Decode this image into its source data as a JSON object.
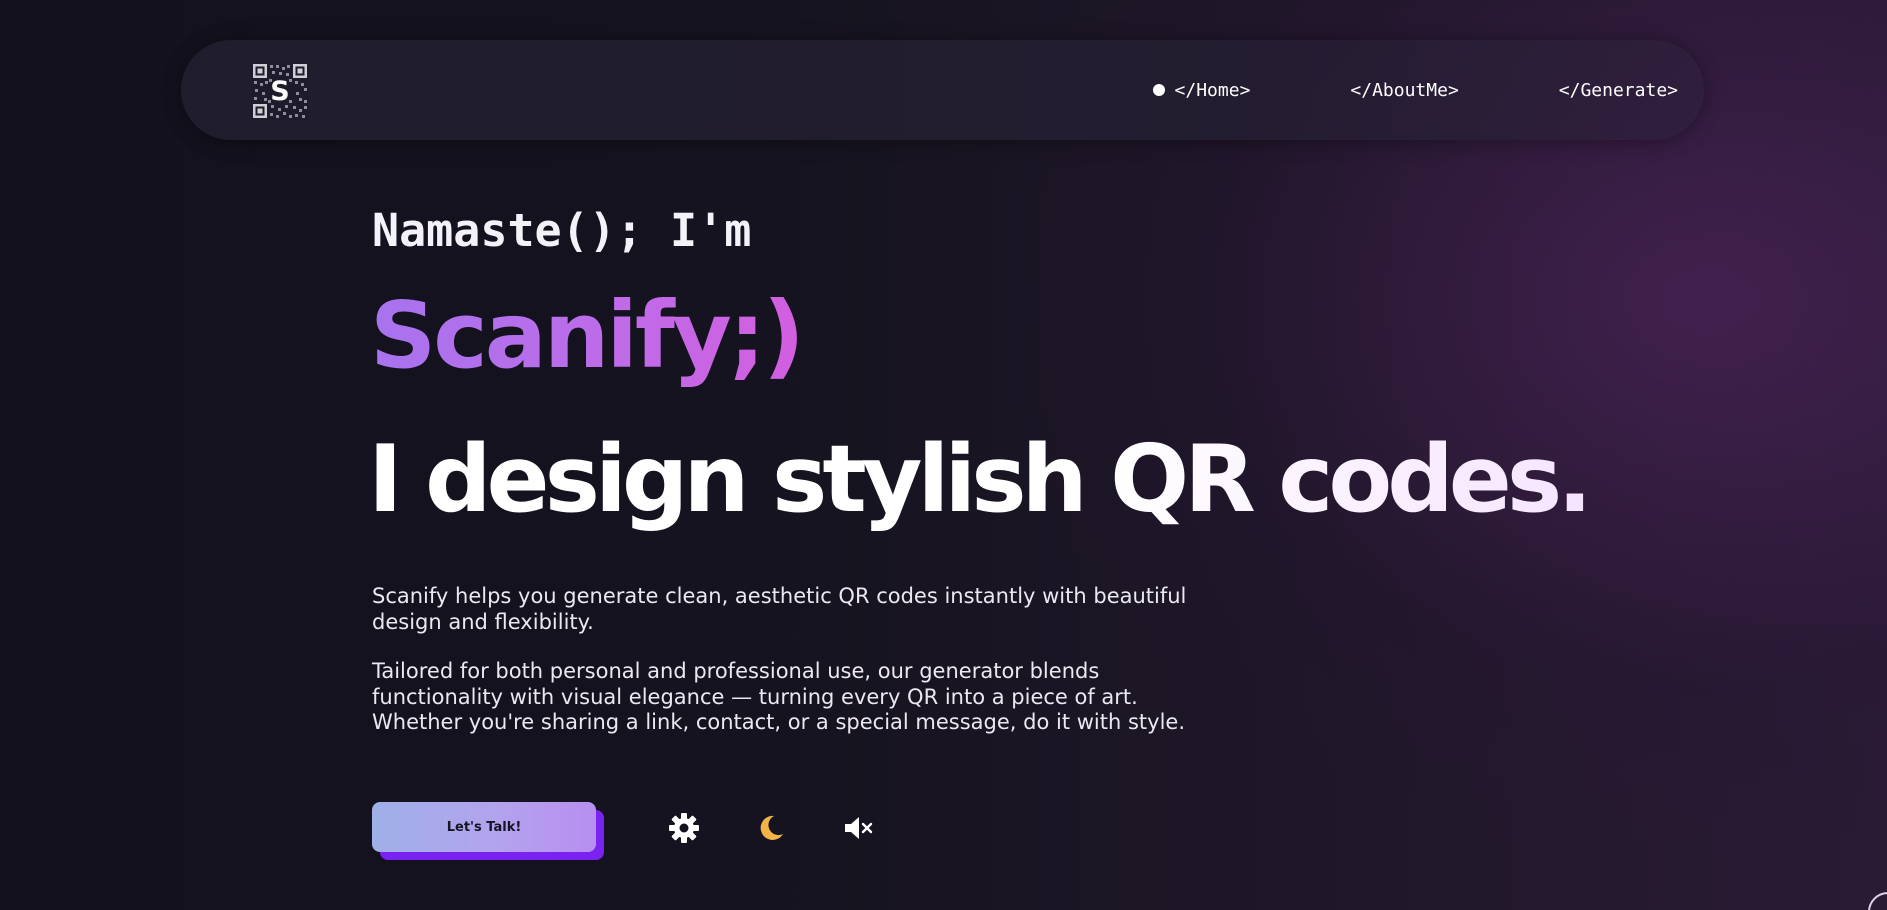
{
  "logo": {
    "letter": "S"
  },
  "nav": {
    "links": [
      {
        "label": "</Home>",
        "active": true
      },
      {
        "label": "</AboutMe>",
        "active": false
      },
      {
        "label": "</Generate>",
        "active": false
      }
    ]
  },
  "hero": {
    "greeting": "Namaste(); I'm",
    "brand": "Scanify;)",
    "tagline": "I design stylish QR codes.",
    "paragraphs": [
      "Scanify helps you generate clean, aesthetic QR codes instantly with beautiful design and flexibility.",
      "Tailored for both personal and professional use, our generator blends functionality with visual elegance — turning every QR into a piece of art. Whether you're sharing a link, contact, or a special message, do it with style."
    ]
  },
  "actions": {
    "cta_label": "Let's Talk!",
    "icons": [
      "gear-icon",
      "moon-icon",
      "speaker-muted-icon"
    ]
  },
  "colors": {
    "brand_gradient_start": "#a873ee",
    "brand_gradient_end": "#d35ee0",
    "button_shadow": "#7a22f0",
    "moon": "#f2b347",
    "background": "#141221"
  }
}
